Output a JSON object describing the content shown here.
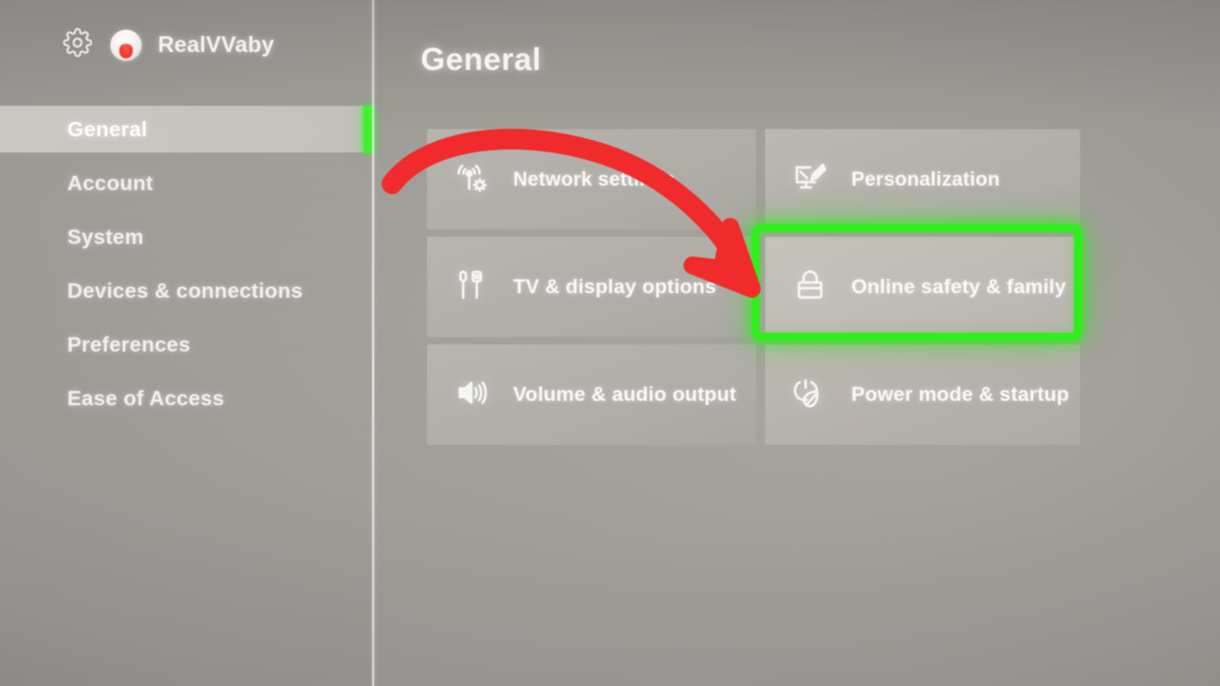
{
  "header": {
    "gear_icon": "gear-icon",
    "avatar_icon": "avatar",
    "gamertag": "RealVVaby"
  },
  "sidebar": {
    "items": [
      {
        "label": "General",
        "selected": true
      },
      {
        "label": "Account",
        "selected": false
      },
      {
        "label": "System",
        "selected": false
      },
      {
        "label": "Devices & connections",
        "selected": false
      },
      {
        "label": "Preferences",
        "selected": false
      },
      {
        "label": "Ease of Access",
        "selected": false
      }
    ]
  },
  "main": {
    "title": "General",
    "tiles": [
      {
        "label": "Network settings",
        "icon": "network-settings-icon",
        "column": "left",
        "highlighted": false
      },
      {
        "label": "Personalization",
        "icon": "personalization-icon",
        "column": "right",
        "highlighted": false
      },
      {
        "label": "TV & display options",
        "icon": "tv-display-icon",
        "column": "left",
        "highlighted": false
      },
      {
        "label": "Online safety & family",
        "icon": "lock-icon",
        "column": "right",
        "highlighted": true
      },
      {
        "label": "Volume & audio output",
        "icon": "volume-icon",
        "column": "left",
        "highlighted": false
      },
      {
        "label": "Power mode & startup",
        "icon": "power-leaf-icon",
        "column": "right",
        "highlighted": false
      }
    ]
  },
  "annotations": {
    "arrow": {
      "name": "red-arrow-annotation",
      "color": "#f22a2a",
      "points_to": "Online safety & family"
    },
    "highlight_box": {
      "name": "green-highlight-box",
      "color": "#2ff01c",
      "targets": "Online safety & family"
    }
  },
  "colors": {
    "accent_green": "#3ef32a",
    "annotation_green": "#2ff01c",
    "annotation_red": "#f22a2a",
    "background_gray": "#a09d98",
    "tile_gray": "#b5b2ad",
    "text_white": "#f7f6f4"
  }
}
